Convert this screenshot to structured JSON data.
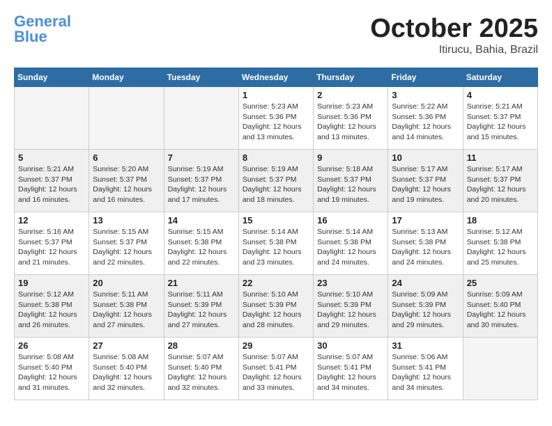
{
  "header": {
    "logo_general": "General",
    "logo_blue": "Blue",
    "logo_sub": "",
    "month_title": "October 2025",
    "location": "Itirucu, Bahia, Brazil"
  },
  "days_of_week": [
    "Sunday",
    "Monday",
    "Tuesday",
    "Wednesday",
    "Thursday",
    "Friday",
    "Saturday"
  ],
  "weeks": [
    [
      {
        "day": "",
        "sunrise": "",
        "sunset": "",
        "daylight": ""
      },
      {
        "day": "",
        "sunrise": "",
        "sunset": "",
        "daylight": ""
      },
      {
        "day": "",
        "sunrise": "",
        "sunset": "",
        "daylight": ""
      },
      {
        "day": "1",
        "sunrise": "Sunrise: 5:23 AM",
        "sunset": "Sunset: 5:36 PM",
        "daylight": "Daylight: 12 hours and 13 minutes."
      },
      {
        "day": "2",
        "sunrise": "Sunrise: 5:23 AM",
        "sunset": "Sunset: 5:36 PM",
        "daylight": "Daylight: 12 hours and 13 minutes."
      },
      {
        "day": "3",
        "sunrise": "Sunrise: 5:22 AM",
        "sunset": "Sunset: 5:36 PM",
        "daylight": "Daylight: 12 hours and 14 minutes."
      },
      {
        "day": "4",
        "sunrise": "Sunrise: 5:21 AM",
        "sunset": "Sunset: 5:37 PM",
        "daylight": "Daylight: 12 hours and 15 minutes."
      }
    ],
    [
      {
        "day": "5",
        "sunrise": "Sunrise: 5:21 AM",
        "sunset": "Sunset: 5:37 PM",
        "daylight": "Daylight: 12 hours and 16 minutes."
      },
      {
        "day": "6",
        "sunrise": "Sunrise: 5:20 AM",
        "sunset": "Sunset: 5:37 PM",
        "daylight": "Daylight: 12 hours and 16 minutes."
      },
      {
        "day": "7",
        "sunrise": "Sunrise: 5:19 AM",
        "sunset": "Sunset: 5:37 PM",
        "daylight": "Daylight: 12 hours and 17 minutes."
      },
      {
        "day": "8",
        "sunrise": "Sunrise: 5:19 AM",
        "sunset": "Sunset: 5:37 PM",
        "daylight": "Daylight: 12 hours and 18 minutes."
      },
      {
        "day": "9",
        "sunrise": "Sunrise: 5:18 AM",
        "sunset": "Sunset: 5:37 PM",
        "daylight": "Daylight: 12 hours and 19 minutes."
      },
      {
        "day": "10",
        "sunrise": "Sunrise: 5:17 AM",
        "sunset": "Sunset: 5:37 PM",
        "daylight": "Daylight: 12 hours and 19 minutes."
      },
      {
        "day": "11",
        "sunrise": "Sunrise: 5:17 AM",
        "sunset": "Sunset: 5:37 PM",
        "daylight": "Daylight: 12 hours and 20 minutes."
      }
    ],
    [
      {
        "day": "12",
        "sunrise": "Sunrise: 5:16 AM",
        "sunset": "Sunset: 5:37 PM",
        "daylight": "Daylight: 12 hours and 21 minutes."
      },
      {
        "day": "13",
        "sunrise": "Sunrise: 5:15 AM",
        "sunset": "Sunset: 5:37 PM",
        "daylight": "Daylight: 12 hours and 22 minutes."
      },
      {
        "day": "14",
        "sunrise": "Sunrise: 5:15 AM",
        "sunset": "Sunset: 5:38 PM",
        "daylight": "Daylight: 12 hours and 22 minutes."
      },
      {
        "day": "15",
        "sunrise": "Sunrise: 5:14 AM",
        "sunset": "Sunset: 5:38 PM",
        "daylight": "Daylight: 12 hours and 23 minutes."
      },
      {
        "day": "16",
        "sunrise": "Sunrise: 5:14 AM",
        "sunset": "Sunset: 5:38 PM",
        "daylight": "Daylight: 12 hours and 24 minutes."
      },
      {
        "day": "17",
        "sunrise": "Sunrise: 5:13 AM",
        "sunset": "Sunset: 5:38 PM",
        "daylight": "Daylight: 12 hours and 24 minutes."
      },
      {
        "day": "18",
        "sunrise": "Sunrise: 5:12 AM",
        "sunset": "Sunset: 5:38 PM",
        "daylight": "Daylight: 12 hours and 25 minutes."
      }
    ],
    [
      {
        "day": "19",
        "sunrise": "Sunrise: 5:12 AM",
        "sunset": "Sunset: 5:38 PM",
        "daylight": "Daylight: 12 hours and 26 minutes."
      },
      {
        "day": "20",
        "sunrise": "Sunrise: 5:11 AM",
        "sunset": "Sunset: 5:38 PM",
        "daylight": "Daylight: 12 hours and 27 minutes."
      },
      {
        "day": "21",
        "sunrise": "Sunrise: 5:11 AM",
        "sunset": "Sunset: 5:39 PM",
        "daylight": "Daylight: 12 hours and 27 minutes."
      },
      {
        "day": "22",
        "sunrise": "Sunrise: 5:10 AM",
        "sunset": "Sunset: 5:39 PM",
        "daylight": "Daylight: 12 hours and 28 minutes."
      },
      {
        "day": "23",
        "sunrise": "Sunrise: 5:10 AM",
        "sunset": "Sunset: 5:39 PM",
        "daylight": "Daylight: 12 hours and 29 minutes."
      },
      {
        "day": "24",
        "sunrise": "Sunrise: 5:09 AM",
        "sunset": "Sunset: 5:39 PM",
        "daylight": "Daylight: 12 hours and 29 minutes."
      },
      {
        "day": "25",
        "sunrise": "Sunrise: 5:09 AM",
        "sunset": "Sunset: 5:40 PM",
        "daylight": "Daylight: 12 hours and 30 minutes."
      }
    ],
    [
      {
        "day": "26",
        "sunrise": "Sunrise: 5:08 AM",
        "sunset": "Sunset: 5:40 PM",
        "daylight": "Daylight: 12 hours and 31 minutes."
      },
      {
        "day": "27",
        "sunrise": "Sunrise: 5:08 AM",
        "sunset": "Sunset: 5:40 PM",
        "daylight": "Daylight: 12 hours and 32 minutes."
      },
      {
        "day": "28",
        "sunrise": "Sunrise: 5:07 AM",
        "sunset": "Sunset: 5:40 PM",
        "daylight": "Daylight: 12 hours and 32 minutes."
      },
      {
        "day": "29",
        "sunrise": "Sunrise: 5:07 AM",
        "sunset": "Sunset: 5:41 PM",
        "daylight": "Daylight: 12 hours and 33 minutes."
      },
      {
        "day": "30",
        "sunrise": "Sunrise: 5:07 AM",
        "sunset": "Sunset: 5:41 PM",
        "daylight": "Daylight: 12 hours and 34 minutes."
      },
      {
        "day": "31",
        "sunrise": "Sunrise: 5:06 AM",
        "sunset": "Sunset: 5:41 PM",
        "daylight": "Daylight: 12 hours and 34 minutes."
      },
      {
        "day": "",
        "sunrise": "",
        "sunset": "",
        "daylight": ""
      }
    ]
  ]
}
